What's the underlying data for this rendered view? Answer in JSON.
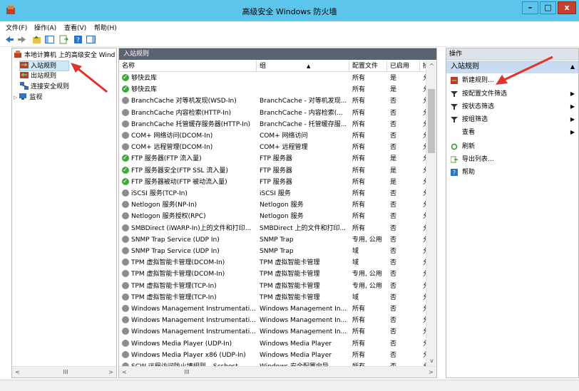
{
  "window": {
    "title": "高级安全 Windows 防火墙",
    "min": "–",
    "max": "□",
    "close": "x"
  },
  "menu": [
    "文件(F)",
    "操作(A)",
    "查看(V)",
    "帮助(H)"
  ],
  "tree": {
    "root": "本地计算机 上的高级安全 Wind",
    "items": [
      "入站规则",
      "出站规则",
      "连接安全规则",
      "监视"
    ]
  },
  "center": {
    "header": "入站规则",
    "columns": [
      "名称",
      "组",
      "配置文件",
      "已启用",
      "操"
    ],
    "rows": [
      {
        "name": "够快云库",
        "group": "",
        "profile": "所有",
        "enabled": "是",
        "op": "允",
        "on": true
      },
      {
        "name": "够快云库",
        "group": "",
        "profile": "所有",
        "enabled": "是",
        "op": "允",
        "on": true
      },
      {
        "name": "BranchCache 对等机发现(WSD-In)",
        "group": "BranchCache - 对等机发现...",
        "profile": "所有",
        "enabled": "否",
        "op": "允",
        "on": false
      },
      {
        "name": "BranchCache 内容检索(HTTP-In)",
        "group": "BranchCache - 内容检索(...",
        "profile": "所有",
        "enabled": "否",
        "op": "允",
        "on": false
      },
      {
        "name": "BranchCache 托管缓存服务器(HTTP-In)",
        "group": "BranchCache - 托管缓存服...",
        "profile": "所有",
        "enabled": "否",
        "op": "允",
        "on": false
      },
      {
        "name": "COM+ 网络访问(DCOM-In)",
        "group": "COM+ 网络访问",
        "profile": "所有",
        "enabled": "否",
        "op": "允",
        "on": false
      },
      {
        "name": "COM+ 远程管理(DCOM-In)",
        "group": "COM+ 远程管理",
        "profile": "所有",
        "enabled": "否",
        "op": "允",
        "on": false
      },
      {
        "name": "FTP 服务器(FTP 流入量)",
        "group": "FTP 服务器",
        "profile": "所有",
        "enabled": "是",
        "op": "允",
        "on": true
      },
      {
        "name": "FTP 服务器安全(FTP SSL 流入量)",
        "group": "FTP 服务器",
        "profile": "所有",
        "enabled": "是",
        "op": "允",
        "on": true
      },
      {
        "name": "FTP 服务器被动(FTP 被动流入量)",
        "group": "FTP 服务器",
        "profile": "所有",
        "enabled": "是",
        "op": "允",
        "on": true
      },
      {
        "name": "iSCSI 服务(TCP-In)",
        "group": "iSCSI 服务",
        "profile": "所有",
        "enabled": "否",
        "op": "允",
        "on": false
      },
      {
        "name": "Netlogon 服务(NP-In)",
        "group": "Netlogon 服务",
        "profile": "所有",
        "enabled": "否",
        "op": "允",
        "on": false
      },
      {
        "name": "Netlogon 服务授权(RPC)",
        "group": "Netlogon 服务",
        "profile": "所有",
        "enabled": "否",
        "op": "允",
        "on": false
      },
      {
        "name": "SMBDirect (iWARP-In)上的文件和打印...",
        "group": "SMBDirect 上的文件和打印...",
        "profile": "所有",
        "enabled": "否",
        "op": "允",
        "on": false
      },
      {
        "name": "SNMP Trap Service (UDP In)",
        "group": "SNMP Trap",
        "profile": "专用, 公用",
        "enabled": "否",
        "op": "允",
        "on": false
      },
      {
        "name": "SNMP Trap Service (UDP In)",
        "group": "SNMP Trap",
        "profile": "域",
        "enabled": "否",
        "op": "允",
        "on": false
      },
      {
        "name": "TPM 虚拟智能卡管理(DCOM-In)",
        "group": "TPM 虚拟智能卡管理",
        "profile": "域",
        "enabled": "否",
        "op": "允",
        "on": false
      },
      {
        "name": "TPM 虚拟智能卡管理(DCOM-In)",
        "group": "TPM 虚拟智能卡管理",
        "profile": "专用, 公用",
        "enabled": "否",
        "op": "允",
        "on": false
      },
      {
        "name": "TPM 虚拟智能卡管理(TCP-In)",
        "group": "TPM 虚拟智能卡管理",
        "profile": "专用, 公用",
        "enabled": "否",
        "op": "允",
        "on": false
      },
      {
        "name": "TPM 虚拟智能卡管理(TCP-In)",
        "group": "TPM 虚拟智能卡管理",
        "profile": "域",
        "enabled": "否",
        "op": "允",
        "on": false
      },
      {
        "name": "Windows Management Instrumentati...",
        "group": "Windows Management In...",
        "profile": "所有",
        "enabled": "否",
        "op": "允",
        "on": false
      },
      {
        "name": "Windows Management Instrumentati...",
        "group": "Windows Management In...",
        "profile": "所有",
        "enabled": "否",
        "op": "允",
        "on": false
      },
      {
        "name": "Windows Management Instrumentati...",
        "group": "Windows Management In...",
        "profile": "所有",
        "enabled": "否",
        "op": "允",
        "on": false
      },
      {
        "name": "Windows Media Player (UDP-In)",
        "group": "Windows Media Player",
        "profile": "所有",
        "enabled": "否",
        "op": "允",
        "on": false
      },
      {
        "name": "Windows Media Player x86 (UDP-In)",
        "group": "Windows Media Player",
        "profile": "所有",
        "enabled": "否",
        "op": "允",
        "on": false
      },
      {
        "name": "SCW 远程访问防火墙规则 – Scshost - ...",
        "group": "Windows 安全配置向导",
        "profile": "所有",
        "enabled": "否",
        "op": "允",
        "on": false
      }
    ]
  },
  "actions": {
    "header": "操作",
    "section": "入站规则",
    "items": [
      {
        "label": "新建规则...",
        "icon": "new-rule-icon",
        "sub": false
      },
      {
        "label": "按配置文件筛选",
        "icon": "filter-icon",
        "sub": true
      },
      {
        "label": "按状态筛选",
        "icon": "filter-icon",
        "sub": true
      },
      {
        "label": "按组筛选",
        "icon": "filter-icon",
        "sub": true
      },
      {
        "label": "查看",
        "icon": "",
        "sub": true
      },
      {
        "label": "刷新",
        "icon": "refresh-icon",
        "sub": false
      },
      {
        "label": "导出列表...",
        "icon": "export-icon",
        "sub": false
      },
      {
        "label": "帮助",
        "icon": "help-icon",
        "sub": false
      }
    ]
  },
  "scroll": {
    "left_label": "III"
  },
  "colors": {
    "titlebar": "#5cc5ec",
    "pane_header": "#5b6370",
    "annotation_arrow": "#e0342a"
  }
}
